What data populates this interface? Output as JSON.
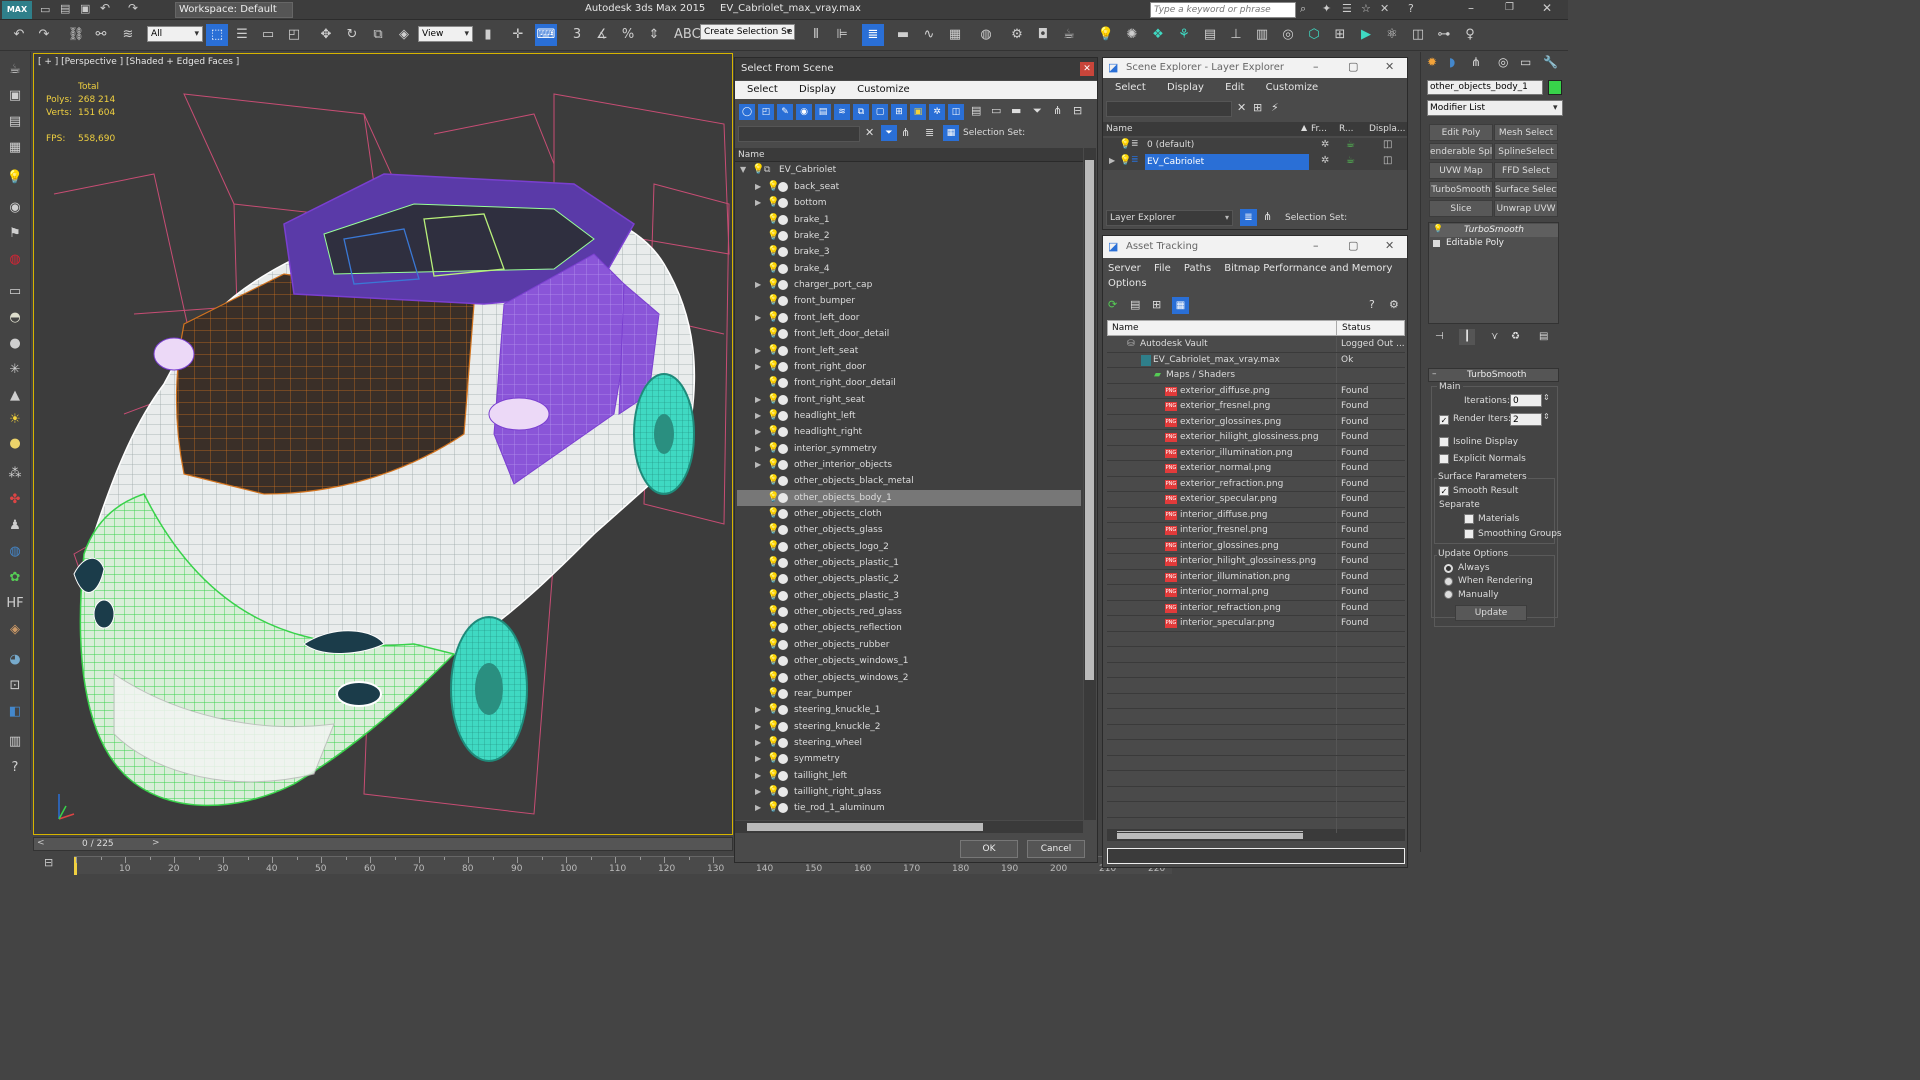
{
  "title_bar": {
    "app_title": "Autodesk 3ds Max  2015",
    "file_title": "EV_Cabriolet_max_vray.max",
    "workspace": "Workspace: Default",
    "search_placeholder": "Type a keyword or phrase"
  },
  "toolbar": {
    "filter_value": "All",
    "ref_coord_value": "View",
    "selection_set_value": "Create Selection Se"
  },
  "viewport": {
    "label": "[ + ] [Perspective ] [Shaded + Edged Faces ]",
    "stats_total": "Total",
    "polys_label": "Polys:",
    "polys_value": "268 214",
    "verts_label": "Verts:",
    "verts_value": "151 604",
    "fps_label": "FPS:",
    "fps_value": "558,690"
  },
  "timeline": {
    "frame_counter": "0 / 225",
    "ticks": [
      "10",
      "20",
      "30",
      "40",
      "50",
      "60",
      "70",
      "80",
      "90",
      "100",
      "110",
      "120",
      "130",
      "140",
      "150",
      "160",
      "170",
      "180",
      "190",
      "200",
      "210",
      "220"
    ]
  },
  "select_dialog": {
    "title": "Select From Scene",
    "menu": [
      "Select",
      "Display",
      "Customize"
    ],
    "selection_set_label": "Selection Set:",
    "column_name": "Name",
    "root": "EV_Cabriolet",
    "items": [
      {
        "label": "back_seat",
        "expandable": true
      },
      {
        "label": "bottom",
        "expandable": true
      },
      {
        "label": "brake_1",
        "expandable": false
      },
      {
        "label": "brake_2",
        "expandable": false
      },
      {
        "label": "brake_3",
        "expandable": false
      },
      {
        "label": "brake_4",
        "expandable": false
      },
      {
        "label": "charger_port_cap",
        "expandable": true
      },
      {
        "label": "front_bumper",
        "expandable": false
      },
      {
        "label": "front_left_door",
        "expandable": true
      },
      {
        "label": "front_left_door_detail",
        "expandable": false
      },
      {
        "label": "front_left_seat",
        "expandable": true
      },
      {
        "label": "front_right_door",
        "expandable": true
      },
      {
        "label": "front_right_door_detail",
        "expandable": false
      },
      {
        "label": "front_right_seat",
        "expandable": true
      },
      {
        "label": "headlight_left",
        "expandable": true
      },
      {
        "label": "headlight_right",
        "expandable": true
      },
      {
        "label": "interior_symmetry",
        "expandable": true
      },
      {
        "label": "other_interior_objects",
        "expandable": true
      },
      {
        "label": "other_objects_black_metal",
        "expandable": false
      },
      {
        "label": "other_objects_body_1",
        "expandable": false,
        "selected": true
      },
      {
        "label": "other_objects_cloth",
        "expandable": false
      },
      {
        "label": "other_objects_glass",
        "expandable": false
      },
      {
        "label": "other_objects_logo_2",
        "expandable": false
      },
      {
        "label": "other_objects_plastic_1",
        "expandable": false
      },
      {
        "label": "other_objects_plastic_2",
        "expandable": false
      },
      {
        "label": "other_objects_plastic_3",
        "expandable": false
      },
      {
        "label": "other_objects_red_glass",
        "expandable": false
      },
      {
        "label": "other_objects_reflection",
        "expandable": false
      },
      {
        "label": "other_objects_rubber",
        "expandable": false
      },
      {
        "label": "other_objects_windows_1",
        "expandable": false
      },
      {
        "label": "other_objects_windows_2",
        "expandable": false
      },
      {
        "label": "rear_bumper",
        "expandable": false
      },
      {
        "label": "steering_knuckle_1",
        "expandable": true
      },
      {
        "label": "steering_knuckle_2",
        "expandable": true
      },
      {
        "label": "steering_wheel",
        "expandable": true
      },
      {
        "label": "symmetry",
        "expandable": true
      },
      {
        "label": "taillight_left",
        "expandable": true
      },
      {
        "label": "taillight_right_glass",
        "expandable": true
      },
      {
        "label": "tie_rod_1_aluminum",
        "expandable": true
      }
    ],
    "ok_label": "OK",
    "cancel_label": "Cancel"
  },
  "scene_explorer": {
    "title": "Scene Explorer - Layer Explorer",
    "menu": [
      "Select",
      "Display",
      "Edit",
      "Customize"
    ],
    "columns": [
      "Name",
      "Fr...",
      "R...",
      "Displa..."
    ],
    "layers": [
      "0 (default)",
      "EV_Cabriolet"
    ],
    "footer_dropdown": "Layer Explorer",
    "selection_set_label": "Selection Set:"
  },
  "asset_tracking": {
    "title": "Asset Tracking",
    "menu": [
      "Server",
      "File",
      "Paths",
      "Bitmap Performance and Memory"
    ],
    "menu2": "Options",
    "col_name": "Name",
    "col_status": "Status",
    "vault": {
      "name": "Autodesk Vault",
      "status": "Logged Out ..."
    },
    "file": {
      "name": "EV_Cabriolet_max_vray.max",
      "status": "Ok"
    },
    "folder": "Maps / Shaders",
    "maps": [
      {
        "name": "exterior_diffuse.png",
        "status": "Found"
      },
      {
        "name": "exterior_fresnel.png",
        "status": "Found"
      },
      {
        "name": "exterior_glossines.png",
        "status": "Found"
      },
      {
        "name": "exterior_hilight_glossiness.png",
        "status": "Found"
      },
      {
        "name": "exterior_illumination.png",
        "status": "Found"
      },
      {
        "name": "exterior_normal.png",
        "status": "Found"
      },
      {
        "name": "exterior_refraction.png",
        "status": "Found"
      },
      {
        "name": "exterior_specular.png",
        "status": "Found"
      },
      {
        "name": "interior_diffuse.png",
        "status": "Found"
      },
      {
        "name": "interior_fresnel.png",
        "status": "Found"
      },
      {
        "name": "interior_glossines.png",
        "status": "Found"
      },
      {
        "name": "interior_hilight_glossiness.png",
        "status": "Found"
      },
      {
        "name": "interior_illumination.png",
        "status": "Found"
      },
      {
        "name": "interior_normal.png",
        "status": "Found"
      },
      {
        "name": "interior_refraction.png",
        "status": "Found"
      },
      {
        "name": "interior_specular.png",
        "status": "Found"
      }
    ]
  },
  "modify_panel": {
    "object_name": "other_objects_body_1",
    "modifier_list": "Modifier List",
    "buttons": [
      "Edit Poly",
      "Mesh Select",
      "enderable Splin",
      "SplineSelect",
      "UVW Map",
      "FFD Select",
      "TurboSmooth",
      "Surface Select",
      "Slice",
      "Unwrap UVW"
    ],
    "stack": [
      "TurboSmooth",
      "Editable Poly"
    ],
    "rollout_title": "TurboSmooth",
    "main_label": "Main",
    "iterations_label": "Iterations:",
    "iterations_value": "0",
    "render_iters_label": "Render Iters:",
    "render_iters_value": "2",
    "isoline_label": "Isoline Display",
    "explicit_normals_label": "Explicit Normals",
    "surface_params_label": "Surface Parameters",
    "smooth_result_label": "Smooth Result",
    "separate_label": "Separate",
    "materials_label": "Materials",
    "smoothing_groups_label": "Smoothing Groups",
    "update_options_label": "Update Options",
    "always_label": "Always",
    "when_rendering_label": "When Rendering",
    "manually_label": "Manually",
    "update_button": "Update"
  },
  "colors": {
    "ui_dark": "#444444",
    "viewport_bg": "#3c3c3c",
    "selection_blue": "#2a6fd6",
    "wire_green": "#38d24a",
    "wire_purple": "#7a3fd0",
    "wire_cyan": "#3fd9c2",
    "wire_orange": "#d2731e",
    "wire_pink": "#e0507e",
    "stats_yellow": "#f0d040"
  }
}
